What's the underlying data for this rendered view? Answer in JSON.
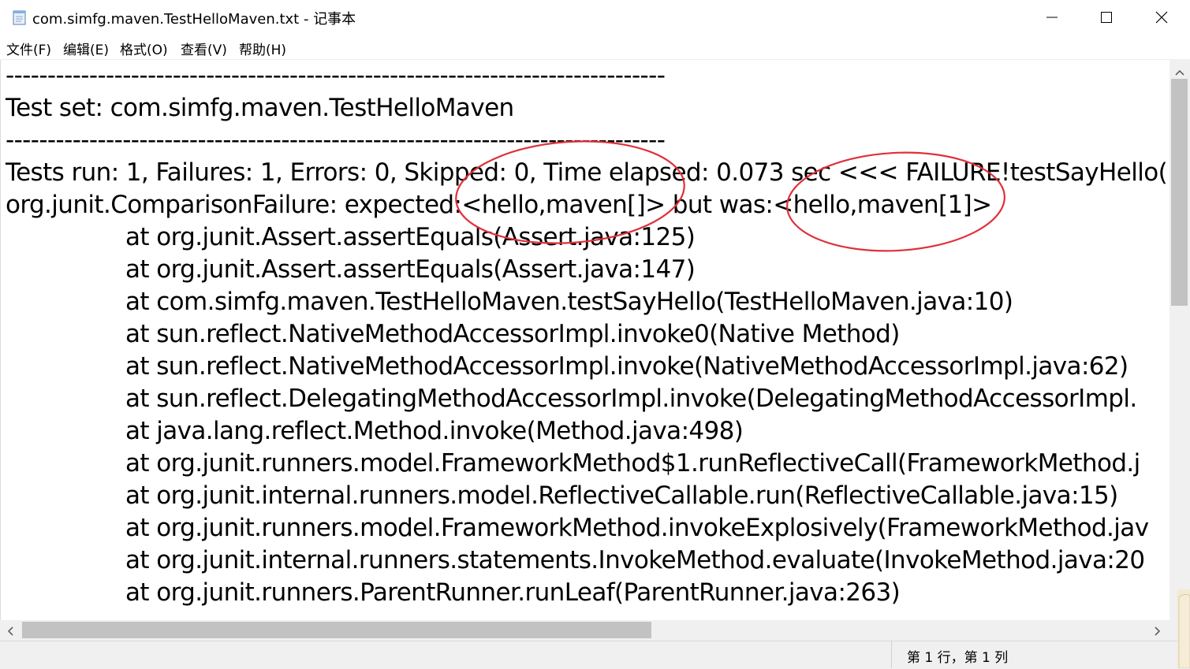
{
  "window": {
    "title": "com.simfg.maven.TestHelloMaven.txt - 记事本",
    "app_icon": "notepad-icon",
    "controls": [
      "minimize-icon",
      "maximize-icon",
      "close-icon"
    ]
  },
  "menu": {
    "items": [
      {
        "label": "文件(F)"
      },
      {
        "label": "编辑(E)"
      },
      {
        "label": "格式(O)"
      },
      {
        "label": "查看(V)"
      },
      {
        "label": "帮助(H)"
      }
    ]
  },
  "document": {
    "lines": [
      "-------------------------------------------------------------------------------",
      "Test set: com.simfg.maven.TestHelloMaven",
      "-------------------------------------------------------------------------------",
      "Tests run: 1, Failures: 1, Errors: 0, Skipped: 0, Time elapsed: 0.073 sec <<< FAILURE!testSayHello(",
      "org.junit.ComparisonFailure: expected:<hello,maven[]> but was:<hello,maven[1]>",
      "at org.junit.Assert.assertEquals(Assert.java:125)",
      "at org.junit.Assert.assertEquals(Assert.java:147)",
      "at com.simfg.maven.TestHelloMaven.testSayHello(TestHelloMaven.java:10)",
      "at sun.reflect.NativeMethodAccessorImpl.invoke0(Native Method)",
      "at sun.reflect.NativeMethodAccessorImpl.invoke(NativeMethodAccessorImpl.java:62)",
      "at sun.reflect.DelegatingMethodAccessorImpl.invoke(DelegatingMethodAccessorImpl.",
      "at java.lang.reflect.Method.invoke(Method.java:498)",
      "at org.junit.runners.model.FrameworkMethod$1.runReflectiveCall(FrameworkMethod.j",
      "at org.junit.internal.runners.model.ReflectiveCallable.run(ReflectiveCallable.java:15)",
      "at org.junit.runners.model.FrameworkMethod.invokeExplosively(FrameworkMethod.jav",
      "at org.junit.internal.runners.statements.InvokeMethod.evaluate(InvokeMethod.java:20",
      "at org.junit.runners.ParentRunner.runLeaf(ParentRunner.java:263)"
    ],
    "annotation_color": "#e0303a"
  },
  "status": {
    "position": "第 1 行，第 1 列"
  }
}
